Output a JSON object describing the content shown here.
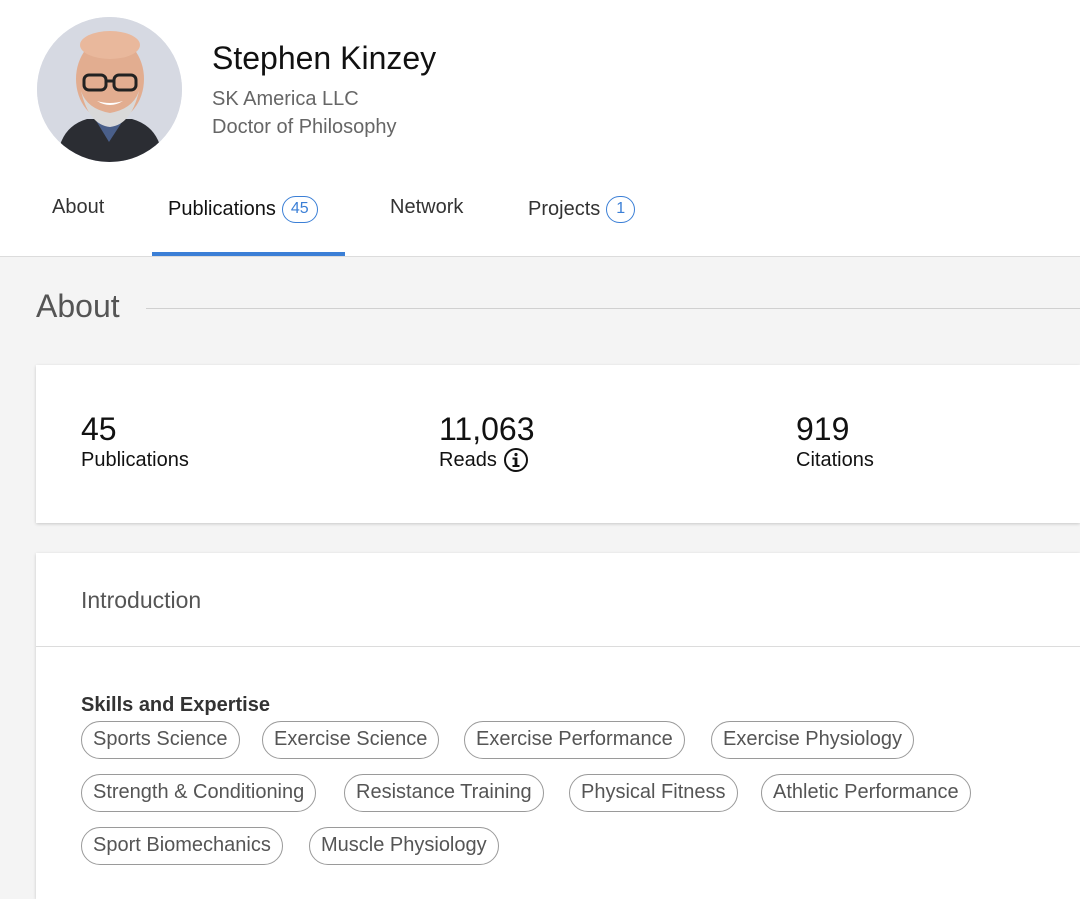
{
  "profile": {
    "name": "Stephen Kinzey",
    "affiliation": "SK America LLC",
    "degree": "Doctor of Philosophy",
    "avatar_icon": "user-photo"
  },
  "tabs": [
    {
      "label": "About"
    },
    {
      "label": "Publications",
      "count": "45"
    },
    {
      "label": "Network"
    },
    {
      "label": "Projects",
      "count": "1"
    }
  ],
  "active_tab": "Publications",
  "about": {
    "title": "About",
    "stats": [
      {
        "value": "45",
        "label": "Publications"
      },
      {
        "value": "11,063",
        "label": "Reads",
        "icon": "info-icon"
      },
      {
        "value": "919",
        "label": "Citations"
      }
    ]
  },
  "intro": {
    "title": "Introduction",
    "skills_heading": "Skills and Expertise",
    "skills": [
      "Sports Science",
      "Exercise Science",
      "Exercise Performance",
      "Exercise Physiology",
      "Strength & Conditioning",
      "Resistance Training",
      "Physical Fitness",
      "Athletic Performance",
      "Sport Biomechanics",
      "Muscle Physiology"
    ]
  },
  "colors": {
    "accent": "#3b7fd6",
    "chip_border": "#9a9a9a",
    "page_bg": "#f4f4f4"
  }
}
